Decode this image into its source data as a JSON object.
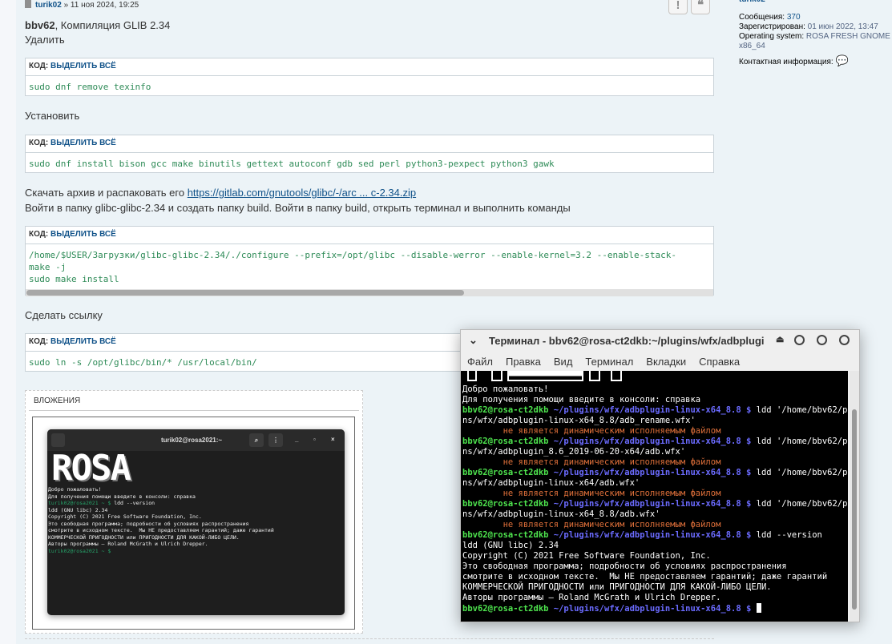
{
  "post": {
    "author": "turik02",
    "sep": " » ",
    "date": "11 ноя 2024, 19:25",
    "report_icon": "!",
    "quote_icon": "❝",
    "greeting_name": "bbv62",
    "greeting_rest": ", Компиляция GLIB 2.34",
    "remove_label": "Удалить",
    "install_label": "Установить",
    "download_text": "Скачать архив и распаковать его ",
    "download_link": "https://gitlab.com/gnutools/glibc/-/arc ... c-2.34.zip",
    "folder_text": "Войти в папку glibc-glibc-2.34 и создать папку build. Войти в папку build, открыть терминал и выполнить команды",
    "link_label": "Сделать ссылку",
    "code_label": "КОД: ",
    "select_all": "ВЫДЕЛИТЬ ВСЁ",
    "code1": "sudo dnf remove texinfo",
    "code2": "sudo dnf install bison gcc make binutils gettext autoconf gdb sed perl python3-pexpect python3 gawk",
    "code3": "/home/$USER/Загрузки/glibc-glibc-2.34/./configure --prefix=/opt/glibc --disable-werror --enable-kernel=3.2 --enable-stack-\nmake -j\nsudo make install",
    "code4": "sudo ln -s /opt/glibc/bin/* /usr/local/bin/",
    "attachments_label": "ВЛОЖЕНИЯ"
  },
  "profile": {
    "name": "turik02",
    "posts_label": "Сообщения: ",
    "posts": "370",
    "reg_label": "Зарегистрирован: ",
    "reg": "01 июн 2022, 13:47",
    "os_label": "Operating system: ",
    "os": "ROSA FRESH GNOME x86_64",
    "contact_label": "Контактная информация: "
  },
  "thumb": {
    "title": "turik02@rosa2021:~",
    "logo": "ROSA",
    "l1": "Добро пожаловать!",
    "l2": "Для получения помощи введите в консоли: справка",
    "prompt": "turik02@rosa2021 ~ $",
    "cmd": " ldd --version",
    "out": "ldd (GNU libc) 2.34\nCopyright (C) 2021 Free Software Foundation, Inc.\nЭто свободная программа; подробности об условиях распространения\nсмотрите в исходном тексте.  Мы НЕ предоставляем гарантий; даже гарантий\nКОММЕРЧЕСКОЙ ПРИГОДНОСТИ или ПРИГОДНОСТИ ДЛЯ КАКОЙ-ЛИБО ЦЕЛИ.\nАвторы программы — Roland McGrath и Ulrich Drepper."
  },
  "terminal": {
    "title": "Терминал - bbv62@rosa-ct2dkb:~/plugins/wfx/adbplugi",
    "menu": [
      "Файл",
      "Правка",
      "Вид",
      "Терминал",
      "Вкладки",
      "Справка"
    ],
    "welcome": "Добро пожаловать!",
    "help": "Для получения помощи введите в консоли: справка",
    "user": "bbv62@rosa-ct2dkb",
    "path": " ~/plugins/wfx/adbplugin-linux-x64_8.8 $",
    "cmd1": " ldd '/home/bbv62/plugi",
    "cont1": "ns/wfx/adbplugin-linux-x64_8.8/adb_rename.wfx'",
    "cmd2": " ldd '/home/bbv62/plugi",
    "cont2": "ns/wfx/adbplugin_8.6_2019-06-20-x64/adb.wfx'",
    "cmd3": " ldd '/home/bbv62/plugi",
    "cont3": "ns/wfx/adbplugin-linux-x64/adb.wfx'",
    "cmd4": " ldd '/home/bbv62/plugi",
    "cont4": "ns/wfx/adbplugin-linux-x64_8.8/adb.wfx'",
    "err": "        не является динамическим исполняемым файлом",
    "cmd5": " ldd --version",
    "out": "ldd (GNU libc) 2.34\nCopyright (C) 2021 Free Software Foundation, Inc.\nЭто свободная программа; подробности об условиях распространения\nсмотрите в исходном тексте.  Мы НЕ предоставляем гарантий; даже гарантий\nКОММЕРЧЕСКОЙ ПРИГОДНОСТИ или ПРИГОДНОСТИ ДЛЯ КАКОЙ-ЛИБО ЦЕЛИ.\nАвторы программы — Roland McGrath и Ulrich Drepper."
  }
}
